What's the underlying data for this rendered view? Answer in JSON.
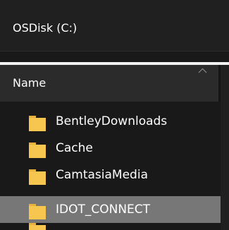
{
  "window": {
    "location_title": "OSDisk (C:)"
  },
  "header": {
    "name_column": "Name",
    "sort_icon": "chevron-up-icon"
  },
  "file_list": {
    "items": [
      {
        "label": "BentleyDownloads",
        "icon": "folder-icon",
        "selected": false
      },
      {
        "label": "Cache",
        "icon": "folder-icon",
        "selected": false
      },
      {
        "label": "CamtasiaMedia",
        "icon": "folder-icon",
        "selected": false
      },
      {
        "label": "IDOT_CONNECT",
        "icon": "folder-icon",
        "selected": true
      }
    ]
  },
  "colors": {
    "background": "#191919",
    "title_bar": "#202020",
    "header": "#2b2b2b",
    "selection": "#777777",
    "folder": "#f7c64f",
    "text": "#ffffff"
  }
}
